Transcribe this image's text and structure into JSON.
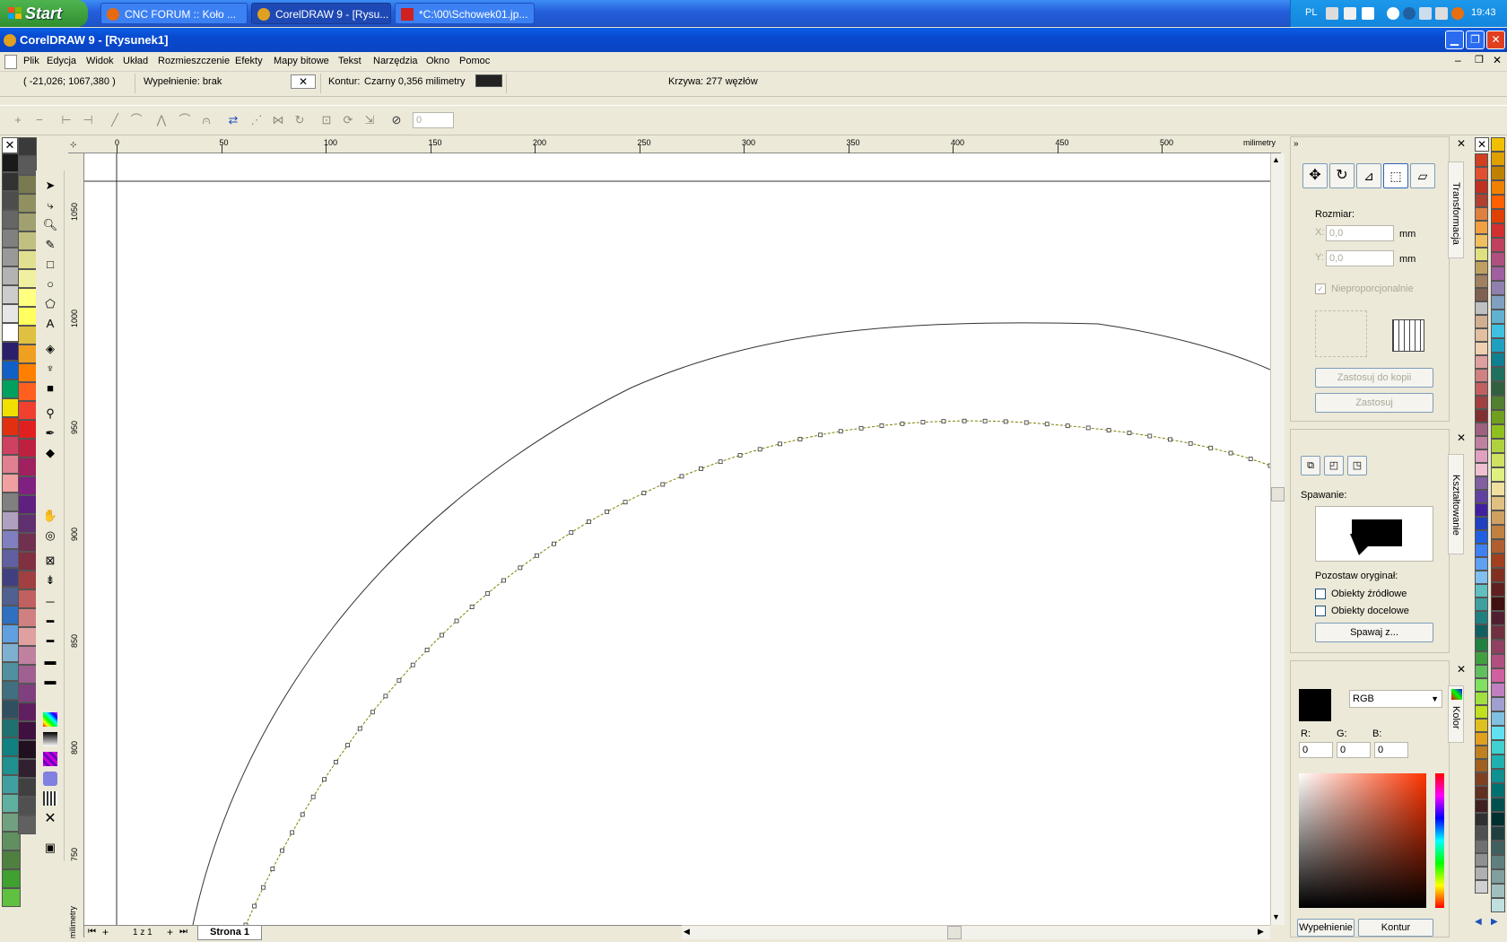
{
  "taskbar": {
    "start_label": "Start",
    "tasks": [
      {
        "label": "CNC FORUM :: Koło ..."
      },
      {
        "label": "CorelDRAW 9 - [Rysu..."
      },
      {
        "label": "*C:\\00\\Schowek01.jp..."
      }
    ],
    "tray": {
      "lang": "PL",
      "clock": "19:43"
    }
  },
  "window": {
    "title": "CorelDRAW 9 - [Rysunek1]"
  },
  "menu": [
    "Plik",
    "Edycja",
    "Widok",
    "Układ",
    "Rozmieszczenie",
    "Efekty",
    "Mapy bitowe",
    "Tekst",
    "Narzędzia",
    "Okno",
    "Pomoc"
  ],
  "propbar": {
    "coords": "( -21,026; 1067,380 )",
    "fill": "Wypełnienie: brak",
    "outline_label": "Kontur:",
    "outline_value": "Czarny 0,356 milimetry",
    "curve": "Krzywa: 277 węzłów",
    "spin_value": "0"
  },
  "rulers": {
    "unit": "milimetry",
    "h_labels": [
      "0",
      "50",
      "100",
      "150",
      "200",
      "250",
      "300",
      "350",
      "400",
      "450",
      "500"
    ],
    "v_labels": [
      "1050",
      "1000",
      "950",
      "900",
      "850",
      "800",
      "750"
    ],
    "v_unit": "milimetry"
  },
  "pages": {
    "counter": "1 z 1",
    "tab": "Strona 1"
  },
  "transform": {
    "tab": "Transformacja",
    "size_label": "Rozmiar:",
    "x_label": "X:",
    "y_label": "Y:",
    "x_value": "0,0",
    "y_value": "0,0",
    "unit": "mm",
    "nonprop": "Nieproporcjonalnie",
    "apply_copy": "Zastosuj do kopii",
    "apply": "Zastosuj"
  },
  "shaping": {
    "tab": "Kształtowanie",
    "mode": "Spawanie:",
    "keep": "Pozostaw oryginał:",
    "src": "Obiekty źródłowe",
    "dst": "Obiekty docelowe",
    "weld_btn": "Spawaj z..."
  },
  "color": {
    "tab": "Kolor",
    "model": "RGB",
    "r_label": "R:",
    "g_label": "G:",
    "b_label": "B:",
    "r": "0",
    "g": "0",
    "b": "0",
    "fill_btn": "Wypełnienie",
    "outline_btn": "Kontur"
  },
  "palette_left": [
    "#1a1a1a",
    "#333333",
    "#4d4d4d",
    "#666666",
    "#808080",
    "#999999",
    "#b3b3b3",
    "#cccccc",
    "#e6e6e6",
    "#ffffff",
    "#2b1f6b",
    "#1060c8",
    "#00a060",
    "#f0e000",
    "#e03010",
    "#d04060",
    "#e08090",
    "#f0a0a0",
    "#808080",
    "#b0a0c0",
    "#8080c0",
    "#6060a0",
    "#404080",
    "#506090",
    "#3070c0",
    "#60a0e0",
    "#80b0d0",
    "#5090a0",
    "#407080",
    "#305060",
    "#207070",
    "#108080",
    "#209090",
    "#40a0a0",
    "#60b0a0",
    "#70a080",
    "#609060",
    "#508040",
    "#40a030",
    "#60c040"
  ],
  "palette_left2": [
    "#3a3a3a",
    "#5a5a5a",
    "#7a7a50",
    "#909060",
    "#a0a070",
    "#c0c080",
    "#e0e090",
    "#f0f0a0",
    "#ffff80",
    "#ffff60",
    "#e0c040",
    "#f0a020",
    "#ff8000",
    "#ff6020",
    "#f04030",
    "#e02020",
    "#c02040",
    "#a02060",
    "#802080",
    "#602080",
    "#603070",
    "#703050",
    "#803040",
    "#a04040",
    "#c06060",
    "#d08080",
    "#e0a0a0",
    "#c080a0",
    "#a06090",
    "#804080",
    "#602060",
    "#401040",
    "#201020",
    "#302030",
    "#404040",
    "#505050",
    "#606060"
  ],
  "palette_right": [
    "#d04020",
    "#e05030",
    "#c03020",
    "#b04030",
    "#e08040",
    "#f0a040",
    "#f0c060",
    "#e0e080",
    "#c0a060",
    "#a08060",
    "#806050",
    "#c0c0c0",
    "#d0b090",
    "#e0c0a0",
    "#f0d0b0",
    "#e0a0a0",
    "#d08080",
    "#c06060",
    "#a04040",
    "#803030",
    "#a06080",
    "#c080a0",
    "#e0a0c0",
    "#f0c0d0",
    "#8060a0",
    "#6040a0",
    "#4020a0",
    "#2040c0",
    "#2060e0",
    "#4080f0",
    "#60a0f0",
    "#80c0f0",
    "#60c0c0",
    "#40a0a0",
    "#208080",
    "#106060",
    "#208040",
    "#40a040",
    "#60c060",
    "#80e060",
    "#a0e040",
    "#c0e020",
    "#e0c020",
    "#e0a020",
    "#c08020",
    "#a06020",
    "#804020",
    "#603020",
    "#402020",
    "#303030",
    "#505050",
    "#707070",
    "#909090",
    "#b0b0b0",
    "#d0d0d0"
  ],
  "palette_right2": [
    "#f0c000",
    "#e0a000",
    "#c08000",
    "#f08000",
    "#ff6000",
    "#e04000",
    "#d03030",
    "#c04060",
    "#b05080",
    "#a060a0",
    "#9080b0",
    "#80a0c0",
    "#60b0d0",
    "#40c0e0",
    "#20a0c0",
    "#108090",
    "#207060",
    "#306040",
    "#508030",
    "#70a020",
    "#90c020",
    "#b0d040",
    "#d0e060",
    "#e0f080",
    "#f0e0a0",
    "#e0c080",
    "#d0a060",
    "#c08040",
    "#b06030",
    "#a04020",
    "#803020",
    "#602020",
    "#401010",
    "#502030",
    "#703040",
    "#904060",
    "#b05080",
    "#d060a0",
    "#c080c0",
    "#a0a0d0",
    "#80c0e0",
    "#60e0f0",
    "#40d0d0",
    "#20b0b0",
    "#109090",
    "#007070",
    "#005050",
    "#003030",
    "#204040",
    "#406060",
    "#608080",
    "#80a0a0",
    "#a0c0c0",
    "#c0e0e0"
  ],
  "colors": {
    "accent": "#0a5fe6",
    "canvas": "#ffffff",
    "node": "#808000"
  }
}
